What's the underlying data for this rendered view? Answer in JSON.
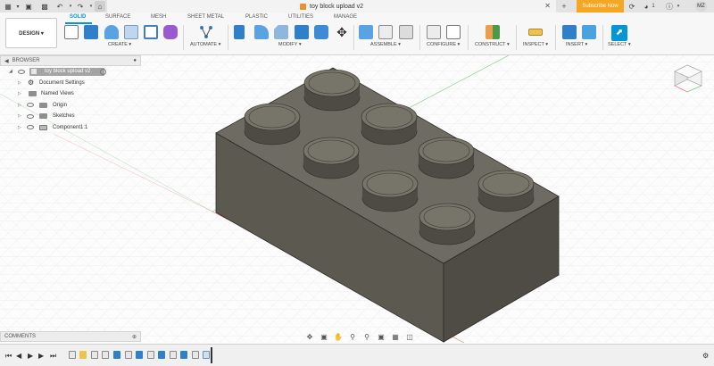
{
  "titlebar": {
    "document_title": "toy block upload v2",
    "subscribe_label": "Subscribe Now",
    "notification_count": "1",
    "user_initials": "MZ"
  },
  "toolbar": {
    "workspace_label": "DESIGN ▾",
    "tabs": [
      "SOLID",
      "SURFACE",
      "MESH",
      "SHEET METAL",
      "PLASTIC",
      "UTILITIES",
      "MANAGE"
    ],
    "active_tab": "SOLID",
    "groups": [
      "CREATE ▾",
      "AUTOMATE ▾",
      "MODIFY ▾",
      "ASSEMBLE ▾",
      "CONFIGURE ▾",
      "CONSTRUCT ▾",
      "INSPECT ▾",
      "INSERT ▾",
      "SELECT ▾"
    ]
  },
  "browser": {
    "title": "BROWSER",
    "root": "toy block upload v2",
    "items": [
      "Document Settings",
      "Named Views",
      "Origin",
      "Sketches",
      "Component1:1"
    ]
  },
  "comments": {
    "title": "COMMENTS"
  },
  "colors": {
    "accent": "#0696d7",
    "subscribe": "#f5a623",
    "model": "#5c5a51"
  },
  "icons": [
    "file-icon",
    "save-icon",
    "undo-icon",
    "redo-icon",
    "home-icon",
    "close-icon",
    "plus-icon",
    "refresh-icon",
    "notification-icon",
    "help-icon",
    "view-cube-icon",
    "play-icon",
    "settings-icon"
  ]
}
